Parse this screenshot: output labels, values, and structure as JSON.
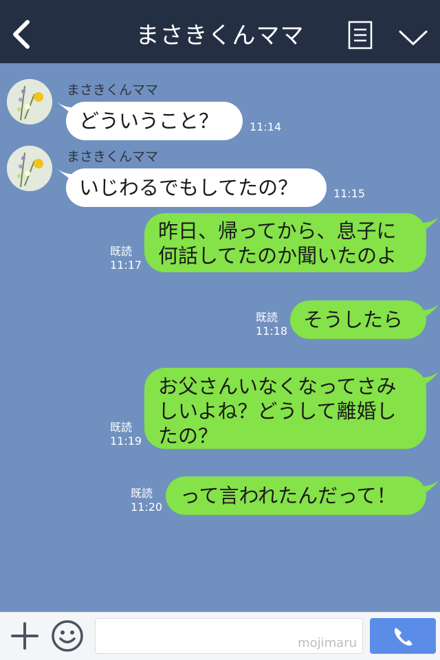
{
  "header": {
    "title": "まさきくんママ",
    "icons": {
      "back": "chevron-left-icon",
      "notes": "note-list-icon",
      "menu": "chevron-down-icon"
    }
  },
  "messages": [
    {
      "direction": "in",
      "sender": "まさきくんママ",
      "text": "どういうこと？",
      "time": "11:14"
    },
    {
      "direction": "in",
      "sender": "まさきくんママ",
      "text": "いじわるでもしてたの？",
      "time": "11:15"
    },
    {
      "direction": "out",
      "lines": [
        "昨日、帰ってから、息子に",
        "何話してたのか聞いたのよ"
      ],
      "read": "既読",
      "time": "11:17"
    },
    {
      "direction": "out",
      "text": "そうしたら",
      "read": "既読",
      "time": "11:18"
    },
    {
      "direction": "out",
      "lines": [
        "お父さんいなくなってさみ",
        "しいよね？どうして離婚し",
        "たの？"
      ],
      "read": "既読",
      "time": "11:19"
    },
    {
      "direction": "out",
      "text": "って言われたんだって！",
      "read": "既読",
      "time": "11:20"
    }
  ],
  "footer": {
    "watermark": "mojimaru",
    "icons": {
      "plus": "plus-icon",
      "emoji": "smiley-icon",
      "call": "phone-icon"
    }
  },
  "colors": {
    "header_bg": "#252f44",
    "chat_bg": "#7090bf",
    "bubble_in": "#ffffff",
    "bubble_out": "#85e249",
    "call_button": "#5b8de8"
  }
}
